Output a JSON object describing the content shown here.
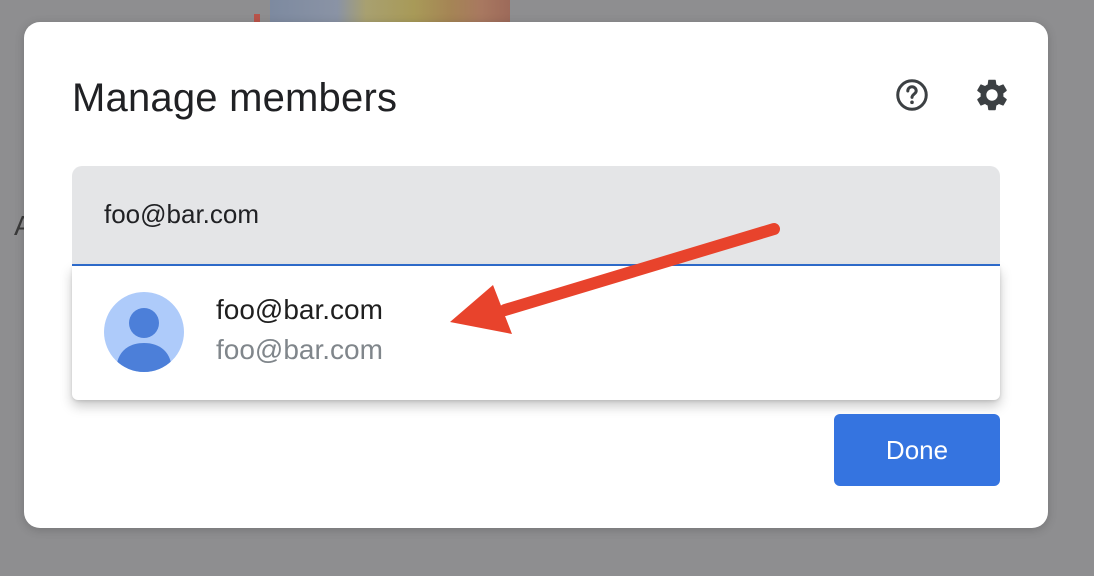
{
  "dialog": {
    "title": "Manage members",
    "help_icon": "help-circle-icon",
    "settings_icon": "gear-icon"
  },
  "search": {
    "value": "foo@bar.com",
    "placeholder": ""
  },
  "suggestions": [
    {
      "name": "foo@bar.com",
      "email": "foo@bar.com",
      "avatar_icon": "person-icon"
    }
  ],
  "actions": {
    "done_label": "Done"
  },
  "annotation": {
    "arrow_icon": "red-arrow-icon"
  },
  "colors": {
    "accent": "#3574e0",
    "field_underline": "#2f6ed1",
    "avatar_bg": "#aecbfa",
    "avatar_fg": "#4c7fd9",
    "arrow": "#e8432c",
    "overlay": "#8e8e90"
  }
}
